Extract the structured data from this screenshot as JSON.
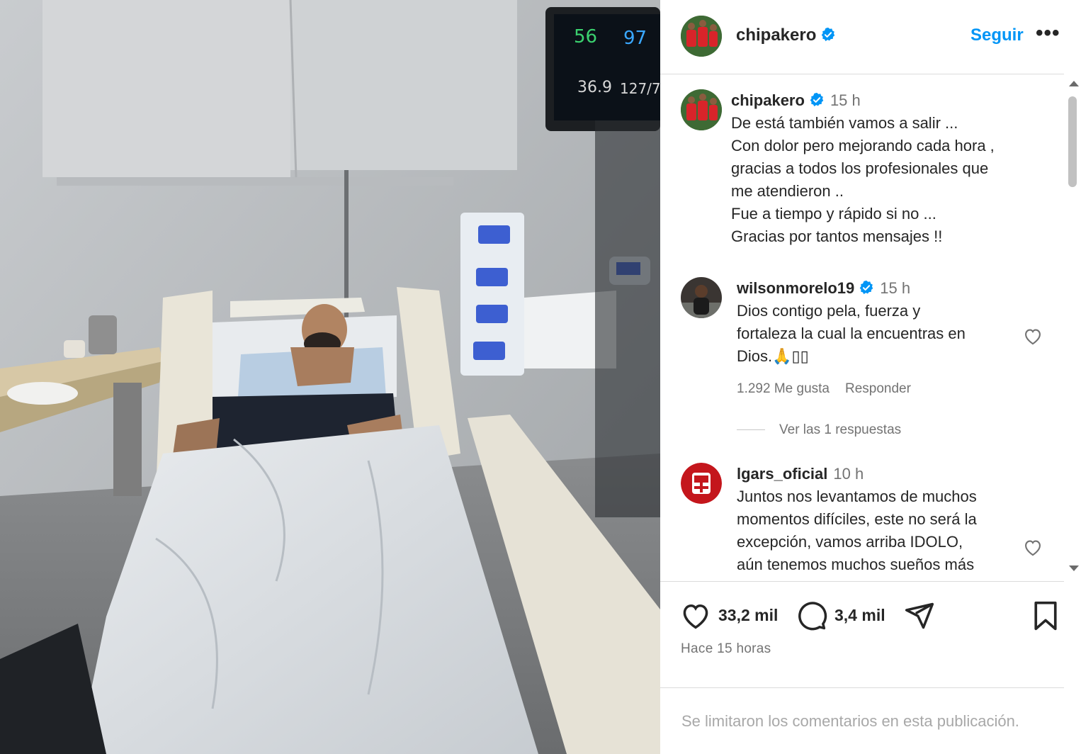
{
  "post": {
    "username": "chipakero",
    "follow_label": "Seguir",
    "more_label": "•••",
    "photo_alt": "foto"
  },
  "caption": {
    "username": "chipakero",
    "time": "15 h",
    "lines": [
      "De está también vamos a salir ...",
      "Con dolor pero mejorando cada hora ,",
      "gracias a todos los profesionales que",
      "me atendieron ..",
      "Fue a tiempo y rápido si no ...",
      "Gracias por tantos mensajes !!"
    ]
  },
  "comments": [
    {
      "username": "wilsonmorelo19",
      "time": "15 h",
      "lines": [
        "Dios contigo pela, fuerza y",
        "fortaleza la cual la encuentras en",
        "Dios.🙏▯▯"
      ],
      "likes": "1.292 Me gusta",
      "reply_label": "Responder",
      "replies_label": "Ver las 1 respuestas"
    },
    {
      "username": "lgars_oficial",
      "time": "10 h",
      "lines": [
        "Juntos nos levantamos de muchos",
        "momentos difíciles, este no será la",
        "excepción, vamos arriba IDOLO,",
        "aún tenemos muchos sueños más"
      ]
    }
  ],
  "actions": {
    "likes": "33,2 mil",
    "comments": "3,4 mil",
    "icons": [
      "heart-icon",
      "comment-icon",
      "share-icon",
      "bookmark-icon"
    ]
  },
  "time_ago": "Hace 15 horas",
  "comments_limited": "Se limitaron los comentarios en esta publicación.",
  "colors": {
    "accent": "#0095f6",
    "verified": "#0095f6",
    "secondary_text": "#737373"
  }
}
